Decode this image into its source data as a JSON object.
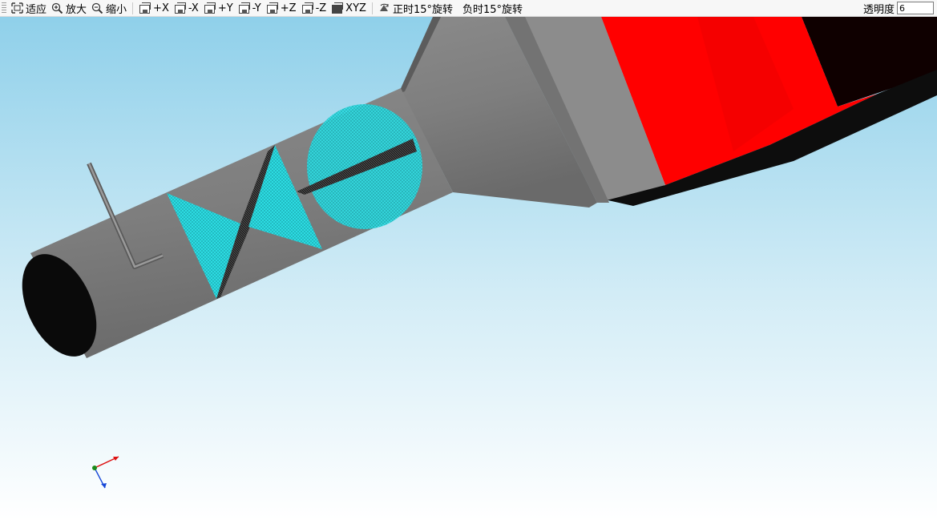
{
  "toolbar": {
    "fit_label": "适应",
    "zoom_in_label": "放大",
    "zoom_out_label": "缩小",
    "view_px_label": "+X",
    "view_nx_label": "-X",
    "view_py_label": "+Y",
    "view_ny_label": "-Y",
    "view_pz_label": "+Z",
    "view_nz_label": "-Z",
    "view_iso_label": "XYZ",
    "rotate_pos_label": "正时15°旋转",
    "rotate_neg_label": "负时15°旋转",
    "opacity_label": "透明度",
    "opacity_value": "6"
  },
  "colors": {
    "sky_top": "#8fd0ea",
    "sky_bottom": "#ffffff",
    "pipe_gray": "#808080",
    "mesh_cyan": "#2ee0e6",
    "hood_red": "#ff0000"
  },
  "icons": {
    "fit": "fit-to-view-icon",
    "zoom_in": "zoom-in-icon",
    "zoom_out": "zoom-out-icon",
    "rotate": "rotate-icon",
    "axes": "axis-triad-icon"
  }
}
